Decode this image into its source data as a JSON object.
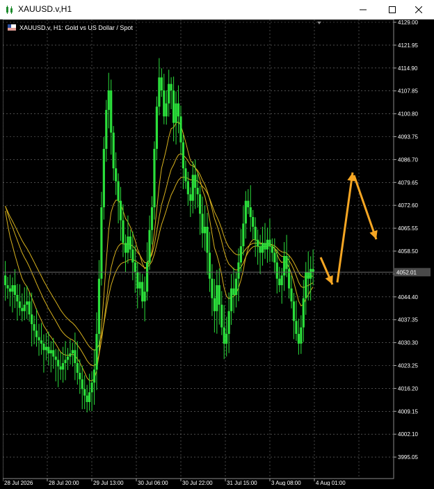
{
  "window": {
    "title": "XAUUSD.v,H1",
    "minimize_icon": "minimize-icon",
    "maximize_icon": "maximize-icon",
    "close_icon": "close-icon"
  },
  "chart": {
    "caption": "XAUUSD.v, H1:  Gold vs US Dollar / Spot",
    "current_price": "4052.01",
    "colors": {
      "background": "#000000",
      "grid": "#7a7a7a",
      "candles": "#2bdf3b",
      "ma": "#d8b21e",
      "price_line": "#6b6b6b",
      "arrows": "#f5a623"
    }
  },
  "chart_data": {
    "type": "bar",
    "symbol": "XAUUSD.v",
    "timeframe": "H1",
    "ylim": [
      3991.0,
      4129.0
    ],
    "y_ticks": [
      "4129.00",
      "4121.95",
      "4114.90",
      "4107.85",
      "4100.80",
      "4093.75",
      "4086.70",
      "4079.65",
      "4072.60",
      "4065.55",
      "4058.50",
      "4051.45",
      "4044.40",
      "4037.35",
      "4030.30",
      "4023.25",
      "4016.20",
      "4009.15",
      "4002.10",
      "3995.05"
    ],
    "x_labels": [
      "28 Jul 2026",
      "28 Jul 20:00",
      "29 Jul 13:00",
      "30 Jul 06:00",
      "30 Jul 22:00",
      "31 Jul 15:00",
      "3 Aug 08:00",
      "4 Aug 01:00"
    ],
    "last_price": 4052.01,
    "closes": [
      4048,
      4047,
      4046,
      4048,
      4045,
      4043,
      4041,
      4040,
      4042,
      4043,
      4039,
      4036,
      4034,
      4032,
      4031,
      4030,
      4028,
      4029,
      4027,
      4028,
      4026,
      4025,
      4023,
      4022,
      4024,
      4025,
      4026,
      4027,
      4028,
      4024,
      4021,
      4019,
      4016,
      4014,
      4012,
      4015,
      4018,
      4022,
      4033,
      4050,
      4072,
      4090,
      4102,
      4108,
      4095,
      4084,
      4080,
      4074,
      4068,
      4061,
      4058,
      4063,
      4059,
      4055,
      4052,
      4047,
      4049,
      4043,
      4046,
      4055,
      4065,
      4072,
      4090,
      4103,
      4112,
      4108,
      4100,
      4104,
      4110,
      4108,
      4098,
      4104,
      4100,
      4092,
      4084,
      4080,
      4076,
      4074,
      4082,
      4078,
      4076,
      4070,
      4064,
      4066,
      4058,
      4050,
      4044,
      4040,
      4048,
      4042,
      4035,
      4030,
      4033,
      4040,
      4047,
      4045,
      4050,
      4055,
      4060,
      4067,
      4074,
      4072,
      4069,
      4066,
      4062,
      4060,
      4058,
      4061,
      4059,
      4062,
      4060,
      4058,
      4055,
      4050,
      4048,
      4051,
      4057,
      4053,
      4047,
      4043,
      4037,
      4033,
      4030,
      4035,
      4044,
      4052,
      4050,
      4053,
      4052
    ],
    "ma_series": [
      {
        "period": 10,
        "start": 4076,
        "values": "computed"
      },
      {
        "period": 20,
        "start": 4075,
        "values": "computed"
      },
      {
        "period": 30,
        "start": 4074,
        "values": "computed"
      }
    ],
    "annotations": [
      "down-arrow",
      "up-arrow",
      "down-arrow"
    ],
    "grid": true
  }
}
